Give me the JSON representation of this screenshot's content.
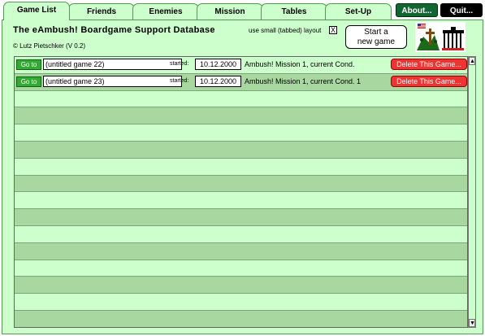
{
  "tabs": [
    {
      "label": "Game List",
      "active": true
    },
    {
      "label": "Friends"
    },
    {
      "label": "Enemies"
    },
    {
      "label": "Mission"
    },
    {
      "label": "Tables"
    },
    {
      "label": "Set-Up"
    }
  ],
  "top_buttons": {
    "about": "About...",
    "quit": "Quit..."
  },
  "header": {
    "title": "The eAmbush! Boardgame Support Database",
    "credit": "© Lutz Pietschker (V 0.2)",
    "layout_label": "use small (tabbed) layout",
    "layout_checked": "X",
    "start_line1": "Start a",
    "start_line2": "new game"
  },
  "games": [
    {
      "goto": "Go to",
      "name": "(untitled game 22)",
      "started_label": "started:",
      "date": "10.12.2000",
      "mission": "Ambush! Mission 1, current Cond.",
      "delete": "Delete This Game..."
    },
    {
      "goto": "Go to",
      "name": "(untitled game 23)",
      "started_label": "started:",
      "date": "10.12.2000",
      "mission": "Ambush! Mission 1, current Cond. 1",
      "delete": "Delete This Game..."
    }
  ],
  "colors": {
    "panel": "#ccffcc",
    "row_alt": "#a8d8a0",
    "delete": "#ee3333",
    "about": "#116633",
    "quit": "#000000"
  },
  "icons": [
    "flag-icon",
    "soldier-icon",
    "brandenburg-gate-icon",
    "scroll-up-icon",
    "scroll-down-icon"
  ]
}
